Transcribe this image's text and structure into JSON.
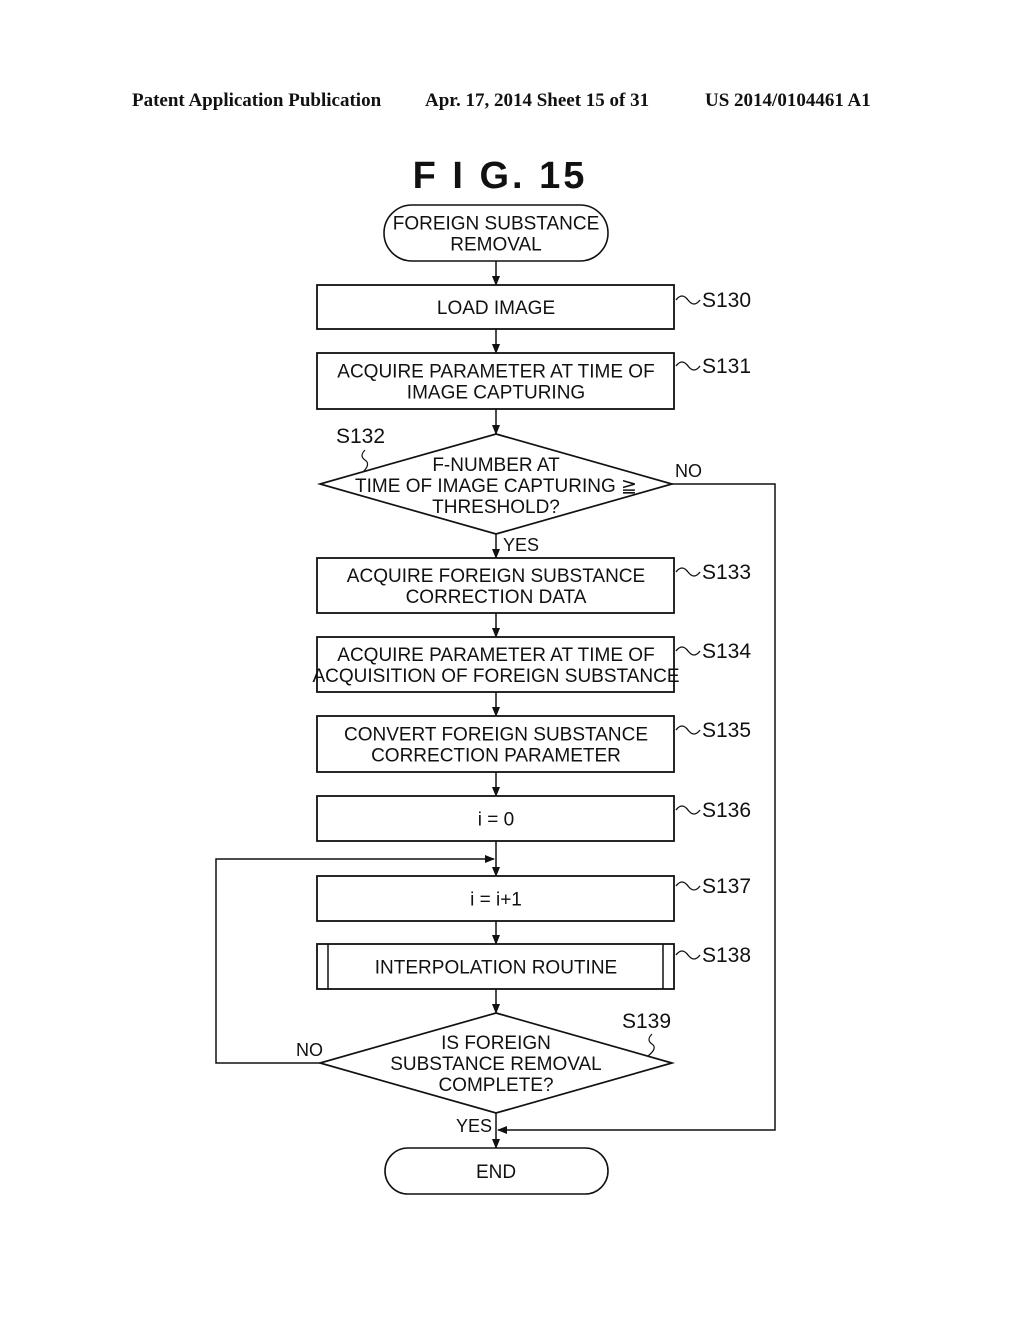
{
  "header": {
    "publication": "Patent Application Publication",
    "date_sheet": "Apr. 17, 2014  Sheet 15 of 31",
    "number": "US 2014/0104461 A1"
  },
  "figure": {
    "title": "F I G. 15"
  },
  "flowchart": {
    "start": {
      "lines": [
        "FOREIGN SUBSTANCE",
        "REMOVAL"
      ]
    },
    "steps": [
      {
        "id": "S130",
        "lines": [
          "LOAD IMAGE"
        ]
      },
      {
        "id": "S131",
        "lines": [
          "ACQUIRE PARAMETER AT TIME OF",
          "IMAGE CAPTURING"
        ]
      },
      {
        "id": "S132",
        "lines": [
          "F-NUMBER AT",
          "TIME OF IMAGE CAPTURING ≧",
          "THRESHOLD?"
        ],
        "yes": "YES",
        "no": "NO"
      },
      {
        "id": "S133",
        "lines": [
          "ACQUIRE FOREIGN SUBSTANCE",
          "CORRECTION DATA"
        ]
      },
      {
        "id": "S134",
        "lines": [
          "ACQUIRE PARAMETER AT TIME OF",
          "ACQUISITION OF FOREIGN SUBSTANCE"
        ]
      },
      {
        "id": "S135",
        "lines": [
          "CONVERT FOREIGN SUBSTANCE",
          "CORRECTION PARAMETER"
        ]
      },
      {
        "id": "S136",
        "lines": [
          "i = 0"
        ]
      },
      {
        "id": "S137",
        "lines": [
          "i = i+1"
        ]
      },
      {
        "id": "S138",
        "lines": [
          "INTERPOLATION ROUTINE"
        ]
      },
      {
        "id": "S139",
        "lines": [
          "IS FOREIGN",
          "SUBSTANCE REMOVAL",
          "COMPLETE?"
        ],
        "yes": "YES",
        "no": "NO"
      }
    ],
    "end": {
      "lines": [
        "END"
      ]
    }
  }
}
